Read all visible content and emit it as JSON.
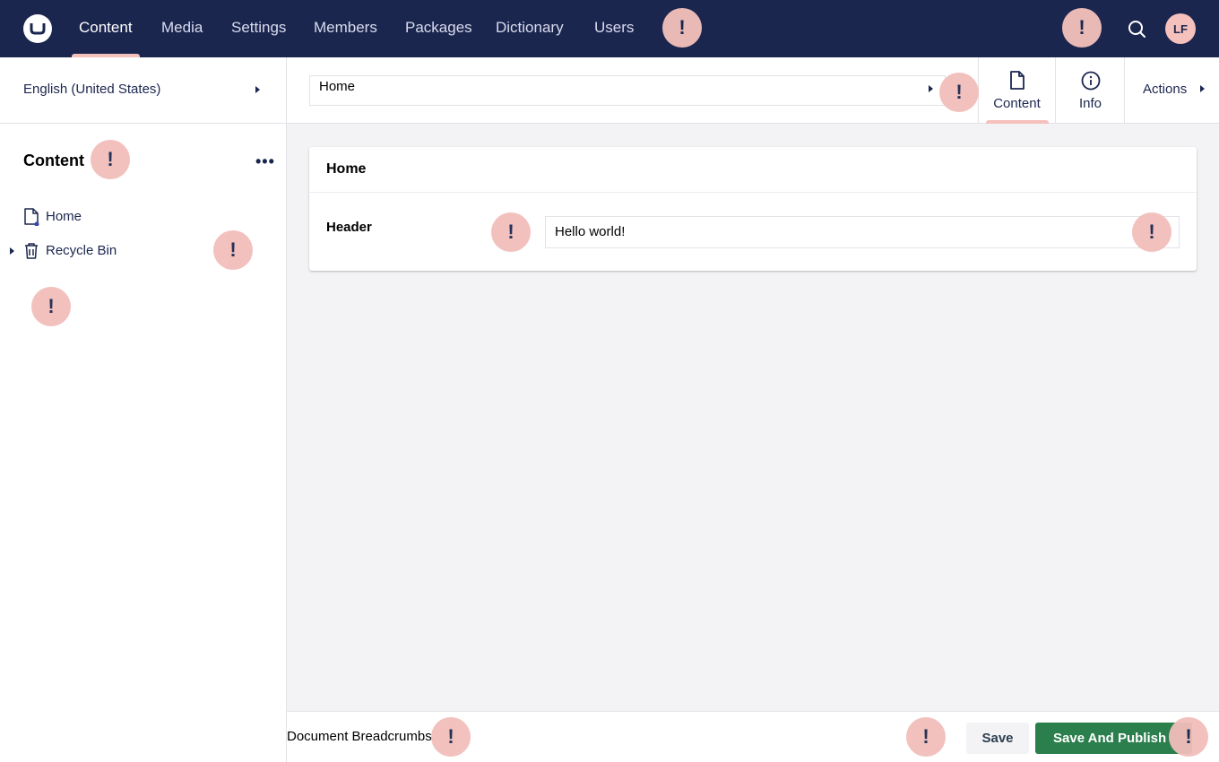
{
  "topbar": {
    "logo": "umbraco-logo",
    "nav": [
      {
        "label": "Content",
        "active": true
      },
      {
        "label": "Media"
      },
      {
        "label": "Settings"
      },
      {
        "label": "Members"
      },
      {
        "label": "Packages"
      },
      {
        "label": "Dictionary"
      },
      {
        "label": "Users"
      }
    ],
    "search_icon": "search-icon",
    "avatar_initials": "LF"
  },
  "warning_marker": "!",
  "sidebar": {
    "language": "English (United States)",
    "title": "Content",
    "menu_icon": "•••",
    "tree": [
      {
        "label": "Home",
        "icon": "document-icon"
      },
      {
        "label": "Recycle Bin",
        "icon": "trash-icon",
        "expandable": true
      }
    ]
  },
  "editor": {
    "name_value": "Home",
    "apps": [
      {
        "label": "Content",
        "icon": "document-icon",
        "active": true
      },
      {
        "label": "Info",
        "icon": "info-icon"
      }
    ],
    "actions_label": "Actions",
    "group_title": "Home",
    "properties": [
      {
        "label": "Header",
        "value": "Hello world!"
      }
    ]
  },
  "footer": {
    "breadcrumbs_label": "Document Breadcrumbs",
    "save_label": "Save",
    "publish_label": "Save And Publish"
  },
  "colors": {
    "topbar": "#1b264f",
    "accent": "#f5c1bc",
    "publish": "#2b7f4d"
  }
}
